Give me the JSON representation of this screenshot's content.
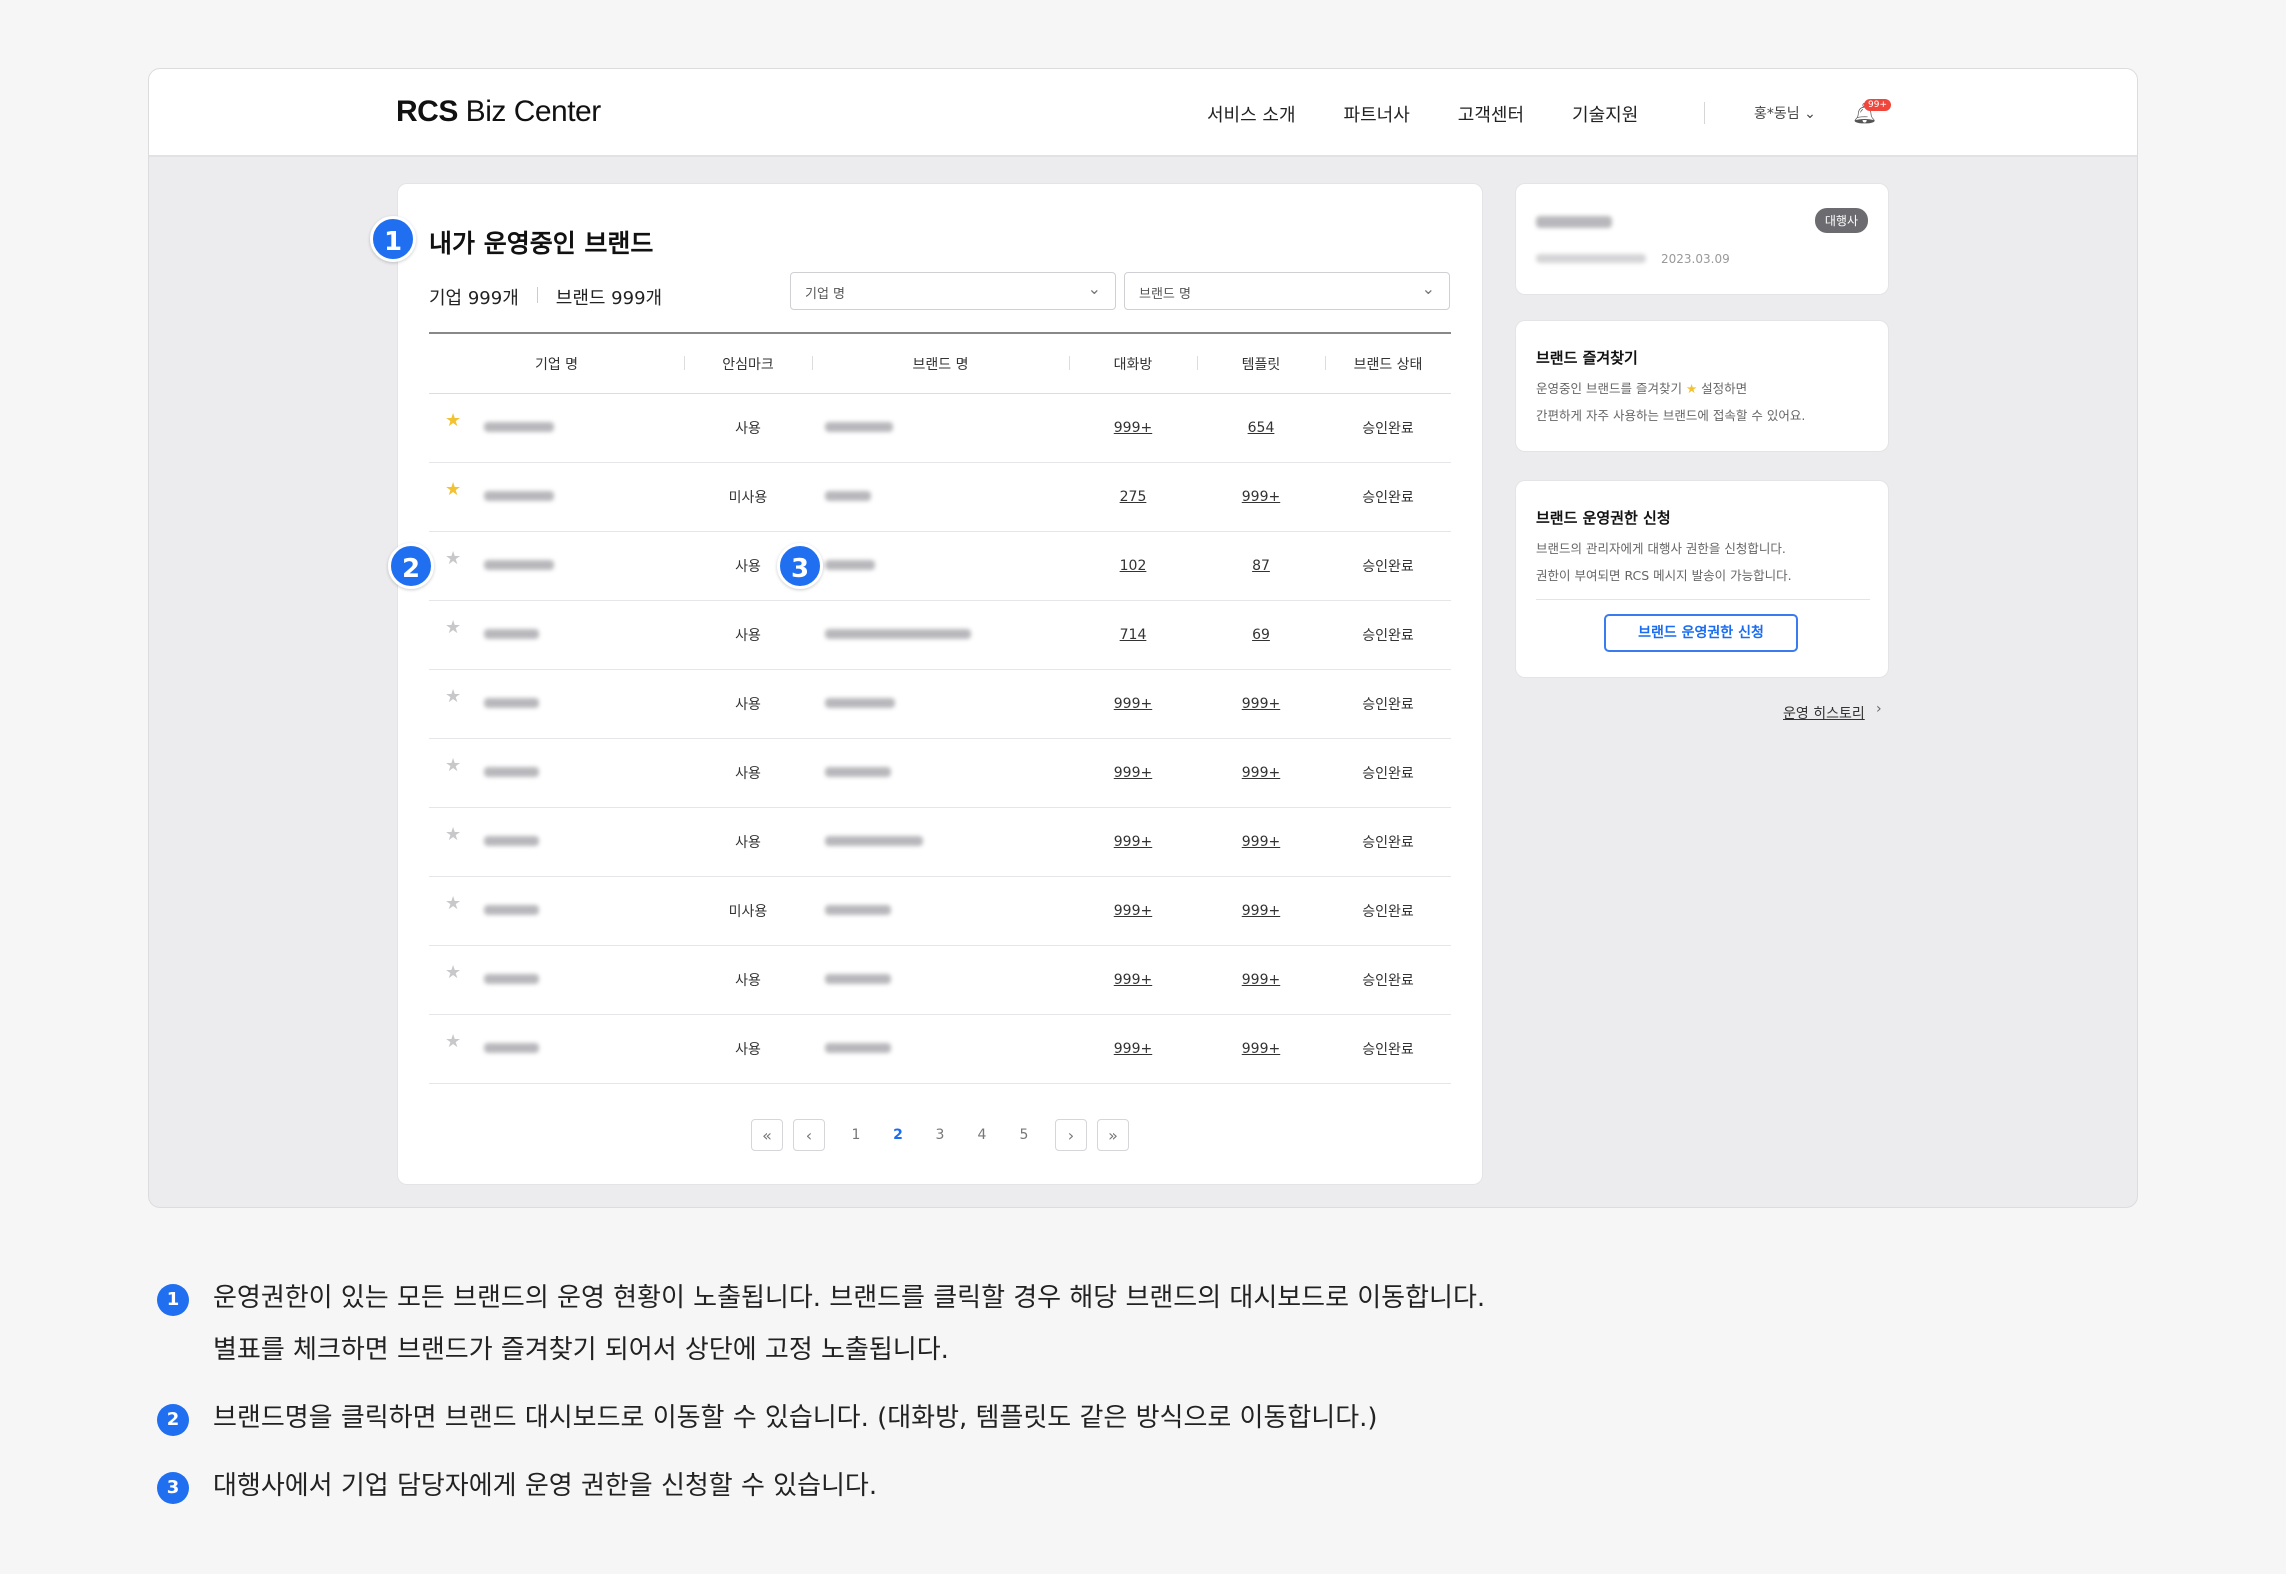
{
  "header": {
    "logo_bold": "RCS",
    "logo_rest": " Biz Center",
    "nav": [
      "서비스 소개",
      "파트너사",
      "고객센터",
      "기술지원"
    ],
    "user": "홍*동님",
    "badge": "99+"
  },
  "main": {
    "title": "내가 운영중인 브랜드",
    "count_company": "기업 999개",
    "count_brand": "브랜드 999개",
    "select_company": "기업 명",
    "select_brand": "브랜드 명",
    "columns": [
      "기업 명",
      "안심마크",
      "브랜드 명",
      "대화방",
      "템플릿",
      "브랜드 상태"
    ],
    "rows": [
      {
        "star": true,
        "mark": "사용",
        "chat": "999+",
        "tpl": "654",
        "status": "승인완료"
      },
      {
        "star": true,
        "mark": "미사용",
        "chat": "275",
        "tpl": "999+",
        "status": "승인완료"
      },
      {
        "star": false,
        "mark": "사용",
        "chat": "102",
        "tpl": "87",
        "status": "승인완료"
      },
      {
        "star": false,
        "mark": "사용",
        "chat": "714",
        "tpl": "69",
        "status": "승인완료"
      },
      {
        "star": false,
        "mark": "사용",
        "chat": "999+",
        "tpl": "999+",
        "status": "승인완료"
      },
      {
        "star": false,
        "mark": "사용",
        "chat": "999+",
        "tpl": "999+",
        "status": "승인완료"
      },
      {
        "star": false,
        "mark": "사용",
        "chat": "999+",
        "tpl": "999+",
        "status": "승인완료"
      },
      {
        "star": false,
        "mark": "미사용",
        "chat": "999+",
        "tpl": "999+",
        "status": "승인완료"
      },
      {
        "star": false,
        "mark": "사용",
        "chat": "999+",
        "tpl": "999+",
        "status": "승인완료"
      },
      {
        "star": false,
        "mark": "사용",
        "chat": "999+",
        "tpl": "999+",
        "status": "승인완료"
      }
    ],
    "pages": [
      "1",
      "2",
      "3",
      "4",
      "5"
    ],
    "current_page": "2"
  },
  "side": {
    "agency_tag": "대행사",
    "agency_date": "2023.03.09",
    "fav_title": "브랜드 즐겨찾기",
    "fav_text1": "운영중인 브랜드를 즐겨찾기",
    "fav_text1b": "설정하면",
    "fav_text2": "간편하게 자주 사용하는 브랜드에 접속할 수 있어요.",
    "req_title": "브랜드 운영권한 신청",
    "req_text1": "브랜드의 관리자에게 대행사 권한을 신청합니다.",
    "req_text2": "권한이 부여되면 RCS 메시지 발송이 가능합니다.",
    "req_button": "브랜드 운영권한 신청",
    "history_link": "운영 히스토리"
  },
  "markers": [
    "1",
    "2",
    "3"
  ],
  "notes": [
    {
      "num": "1",
      "lines": [
        "운영권한이 있는 모든 브랜드의 운영 현황이 노출됩니다. 브랜드를 클릭할 경우 해당 브랜드의 대시보드로 이동합니다.",
        "별표를 체크하면 브랜드가 즐겨찾기 되어서 상단에 고정 노출됩니다."
      ]
    },
    {
      "num": "2",
      "lines": [
        "브랜드명을 클릭하면 브랜드 대시보드로 이동할 수 있습니다. (대화방, 템플릿도 같은 방식으로 이동합니다.)"
      ]
    },
    {
      "num": "3",
      "lines": [
        "대행사에서 기업 담당자에게 운영 권한을 신청할 수 있습니다."
      ]
    }
  ],
  "colors": {
    "accent": "#1f6ff0",
    "star_on": "#f2c230",
    "badge": "#f0463c"
  }
}
